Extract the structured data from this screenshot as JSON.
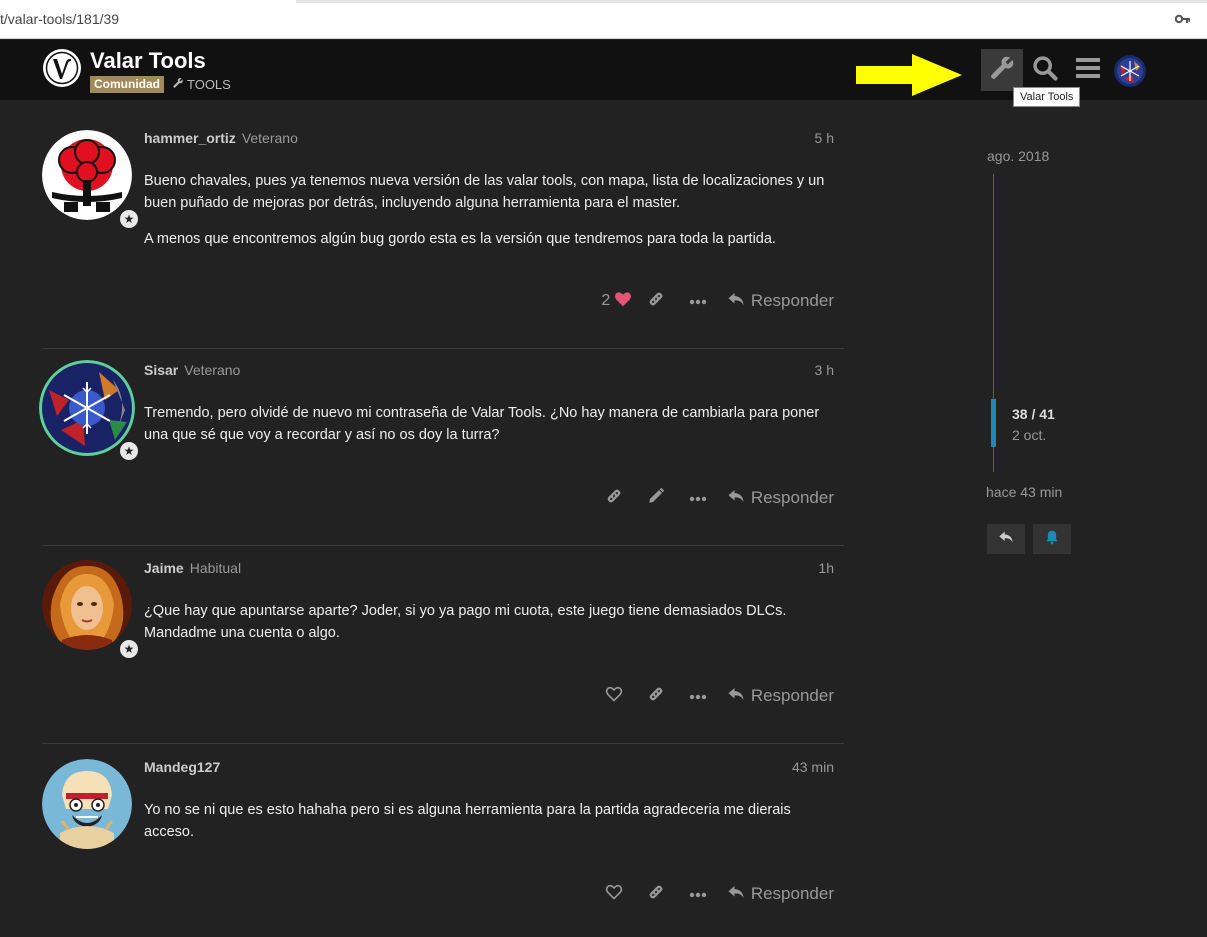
{
  "browser": {
    "url": "t/valar-tools/181/39"
  },
  "header": {
    "site_title": "Valar Tools",
    "category": "Comunidad",
    "tag": "TOOLS",
    "tooltip": "Valar Tools"
  },
  "posts": [
    {
      "username": "hammer_ortiz",
      "title": "Veterano",
      "time": "5 h",
      "paragraphs": [
        "Bueno chavales, pues ya tenemos nueva versión de las valar tools, con mapa, lista de localizaciones y un buen puñado de mejoras por detrás, incluyendo alguna herramienta para el master.",
        "A menos que encontremos algún bug gordo esta es la versión que tendremos para toda la partida."
      ],
      "likes": "2",
      "reply_label": "Responder"
    },
    {
      "username": "Sisar",
      "title": "Veterano",
      "time": "3 h",
      "paragraphs": [
        "Tremendo, pero olvidé de nuevo mi contraseña de Valar Tools. ¿No hay manera de cambiarla para poner una que sé que voy a recordar y así no os doy la turra?"
      ],
      "reply_label": "Responder"
    },
    {
      "username": "Jaime",
      "title": "Habitual",
      "time": "1h",
      "paragraphs": [
        "¿Que hay que apuntarse aparte? Joder, si yo ya pago mi cuota, este juego tiene demasiados DLCs. Mandadme una cuenta o algo."
      ],
      "reply_label": "Responder"
    },
    {
      "username": "Mandeg127",
      "title": "",
      "time": "43 min",
      "paragraphs": [
        "Yo no se ni que es esto hahaha pero si es alguna herramienta para la partida agradeceria me dierais acceso."
      ],
      "reply_label": "Responder"
    }
  ],
  "timeline": {
    "start_date": "ago. 2018",
    "position": "38 / 41",
    "position_date": "2 oct.",
    "end_label": "hace 43 min"
  },
  "colors": {
    "accent": "#1e88b8",
    "like_heart": "#e45575",
    "annotation_arrow": "#ffff00",
    "category_badge": "#a08a5a"
  }
}
